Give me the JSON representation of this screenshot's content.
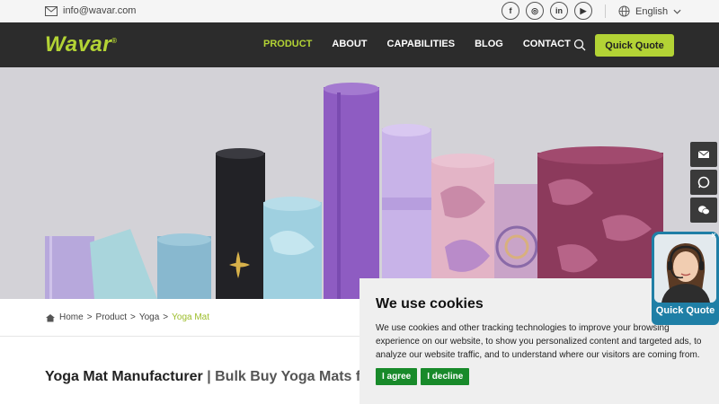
{
  "topbar": {
    "email": "info@wavar.com",
    "social_icons": [
      "facebook-icon",
      "instagram-icon",
      "linkedin-icon",
      "youtube-icon"
    ],
    "social_glyphs": [
      "f",
      "◎",
      "in",
      "▶"
    ],
    "language": "English"
  },
  "nav": {
    "logo": "Wavar",
    "logo_mark": "®",
    "items": [
      {
        "label": "PRODUCT",
        "active": true
      },
      {
        "label": "ABOUT",
        "active": false
      },
      {
        "label": "CAPABILITIES",
        "active": false
      },
      {
        "label": "BLOG",
        "active": false
      },
      {
        "label": "CONTACT",
        "active": false
      }
    ],
    "quick_quote": "Quick Quote"
  },
  "breadcrumb": {
    "items": [
      "Home",
      "Product",
      "Yoga"
    ],
    "separator": ">",
    "current": "Yoga Mat"
  },
  "heading": {
    "main": "Yoga Mat Manufacturer",
    "sub": "| Bulk Buy Yoga Mats fro"
  },
  "cookie": {
    "title": "We use cookies",
    "text": "We use cookies and other tracking technologies to improve your browsing experience on our website, to show you personalized content and targeted ads, to analyze our website traffic, and to understand where our visitors are coming from.",
    "agree": "I agree",
    "decline": "I decline"
  },
  "side_widgets": [
    "email-icon",
    "whatsapp-icon",
    "wechat-icon"
  ],
  "chat": {
    "label": "Quick Quote",
    "close": "×"
  },
  "colors": {
    "accent": "#b3d335",
    "nav_bg": "#2c2c2c",
    "cookie_button": "#188a2a",
    "chat": "#1f7fa6"
  }
}
